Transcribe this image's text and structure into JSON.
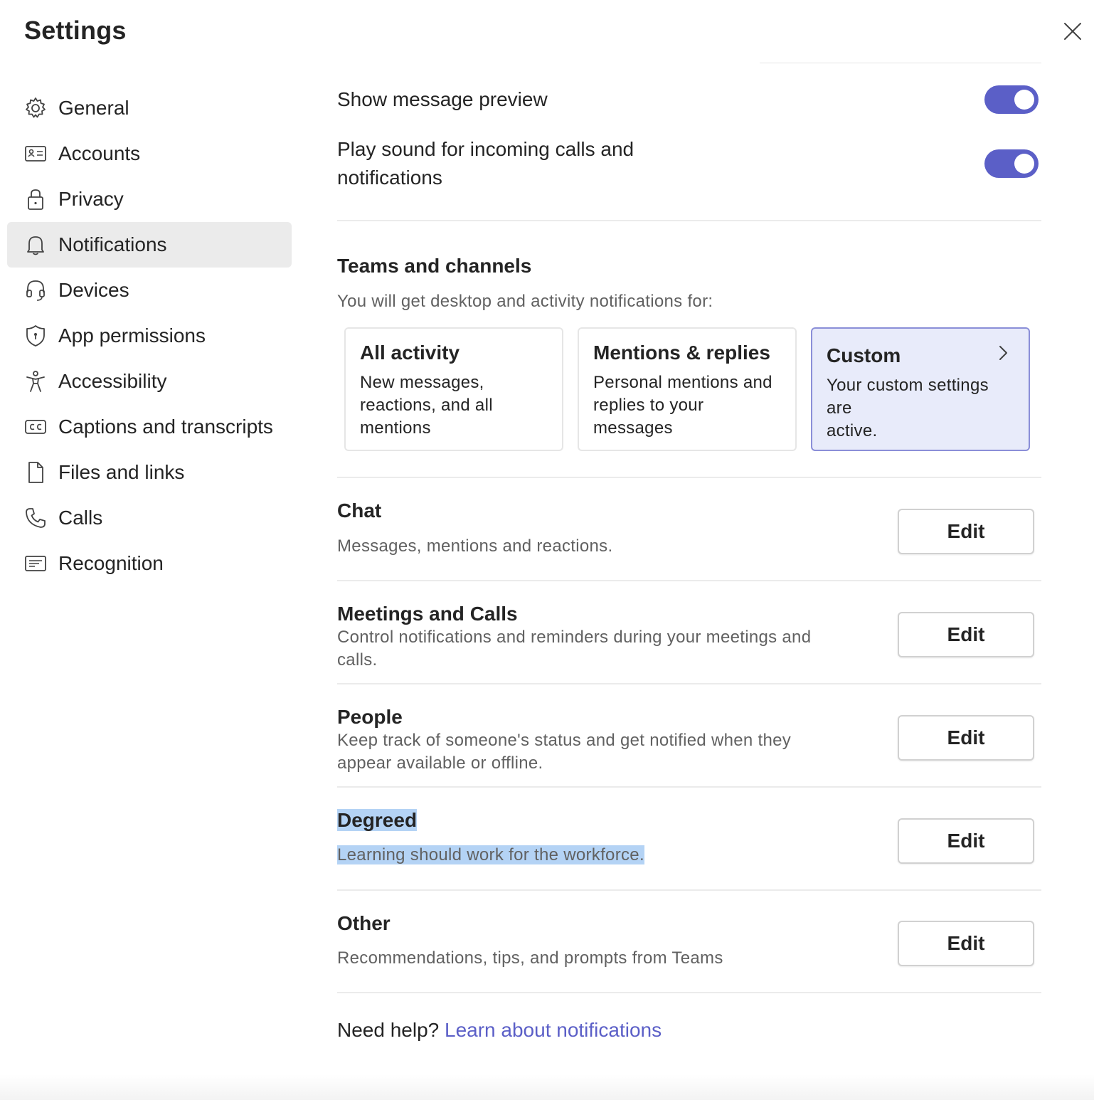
{
  "header": {
    "title": "Settings",
    "close_icon": "close-icon"
  },
  "sidebar": {
    "items": [
      {
        "label": "General",
        "icon": "gear-icon"
      },
      {
        "label": "Accounts",
        "icon": "id-card-icon"
      },
      {
        "label": "Privacy",
        "icon": "lock-icon"
      },
      {
        "label": "Notifications",
        "icon": "bell-icon",
        "active": true
      },
      {
        "label": "Devices",
        "icon": "headset-icon"
      },
      {
        "label": "App permissions",
        "icon": "shield-icon"
      },
      {
        "label": "Accessibility",
        "icon": "accessibility-icon"
      },
      {
        "label": "Captions and transcripts",
        "icon": "cc-icon"
      },
      {
        "label": "Files and links",
        "icon": "file-icon"
      },
      {
        "label": "Calls",
        "icon": "phone-icon"
      },
      {
        "label": "Recognition",
        "icon": "recognition-icon"
      }
    ]
  },
  "toggles": {
    "message_preview": {
      "label": "Show message preview",
      "on": true
    },
    "play_sound": {
      "label_line1": "Play sound for incoming calls and",
      "label_line2": "notifications",
      "on": true
    }
  },
  "teams_channels": {
    "title": "Teams and channels",
    "description": "You will get desktop and activity notifications for:",
    "cards": [
      {
        "title": "All activity",
        "line1": "New messages,",
        "line2": "reactions, and all",
        "line3": "mentions"
      },
      {
        "title": "Mentions & replies",
        "line1": "Personal mentions and",
        "line2": "replies to your messages",
        "line3": ""
      },
      {
        "title": "Custom",
        "line1": "Your custom settings are",
        "line2": "active.",
        "line3": "",
        "selected": true
      }
    ]
  },
  "sections": {
    "chat": {
      "title": "Chat",
      "desc1": "Messages, mentions and reactions.",
      "button": "Edit"
    },
    "meetings": {
      "title": "Meetings and Calls",
      "desc1": "Control notifications and reminders during your meetings and",
      "desc2": "calls.",
      "button": "Edit"
    },
    "people": {
      "title": "People",
      "desc1": "Keep track of someone's status and get notified when they",
      "desc2": "appear available or offline.",
      "button": "Edit"
    },
    "degreed": {
      "title": "Degreed",
      "desc1": "Learning should work for the workforce.",
      "button": "Edit"
    },
    "other": {
      "title": "Other",
      "desc1": "Recommendations, tips, and prompts from Teams",
      "button": "Edit"
    }
  },
  "help": {
    "prefix": "Need help?",
    "link": "Learn about notifications"
  },
  "colors": {
    "accent": "#5b5fc7",
    "selected_card_bg": "#e8ebfa",
    "highlight": "#b4d3f5"
  }
}
